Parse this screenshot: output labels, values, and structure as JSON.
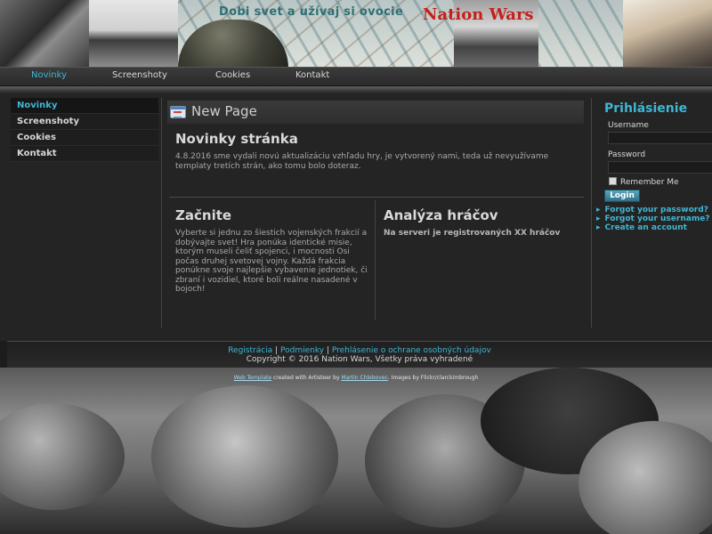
{
  "header": {
    "slogan": "Dobi svet a užívaj si ovocie",
    "logo": "Nation Wars"
  },
  "topnav": {
    "items": [
      {
        "label": "Novinky",
        "active": true
      },
      {
        "label": "Screenshoty",
        "active": false
      },
      {
        "label": "Cookies",
        "active": false
      },
      {
        "label": "Kontakt",
        "active": false
      }
    ]
  },
  "sidebar": {
    "items": [
      {
        "label": "Novinky",
        "active": true
      },
      {
        "label": "Screenshoty",
        "active": false
      },
      {
        "label": "Cookies",
        "active": false
      },
      {
        "label": "Kontakt",
        "active": false
      }
    ]
  },
  "page": {
    "title": "New Page",
    "news_heading": "Novinky stránka",
    "news_text": "4.8.2016 sme vydali novú aktualizáciu vzhľadu hry, je vytvorený nami, teda už nevyužívame templaty tretích strán, ako tomu bolo doteraz.",
    "start_heading": "Začnite",
    "start_text": "Vyberte si jednu zo šiestich vojenských frakcií a dobývajte svet! Hra ponúka identické misie, ktorým museli čeliť spojenci, i mocnosti Osi počas druhej svetovej vojny. Každá frakcia ponúkne svoje najlepšie vybavenie jednotiek, či zbraní i vozidiel, ktoré boli reálne nasadené v bojoch!",
    "analysis_heading": "Analýza hráčov",
    "analysis_text": "Na serveri je registrovaných XX hráčov"
  },
  "login": {
    "title": "Prihlásienie",
    "username_label": "Username",
    "password_label": "Password",
    "remember_label": "Remember Me",
    "button": "Login",
    "links": [
      "Forgot your password?",
      "Forgot your username?",
      "Create an account"
    ]
  },
  "footer": {
    "link1": "Registrácia",
    "link2": "Podmienky",
    "link3": "Prehlásenie o ochrane osobných údajov",
    "separator": "|",
    "copyright": "Copyright © 2016 Nation Wars, Všetky práva vyhradené"
  },
  "credit": {
    "link1": "Web Template",
    "text1": " created with Artisteer by ",
    "link2": "Martin Chlebovec",
    "text2": ". Images by Flickr/clarckimbrough"
  },
  "colors": {
    "accent": "#3fb6d4",
    "logo_red": "#c5201b",
    "background": "#242424"
  }
}
